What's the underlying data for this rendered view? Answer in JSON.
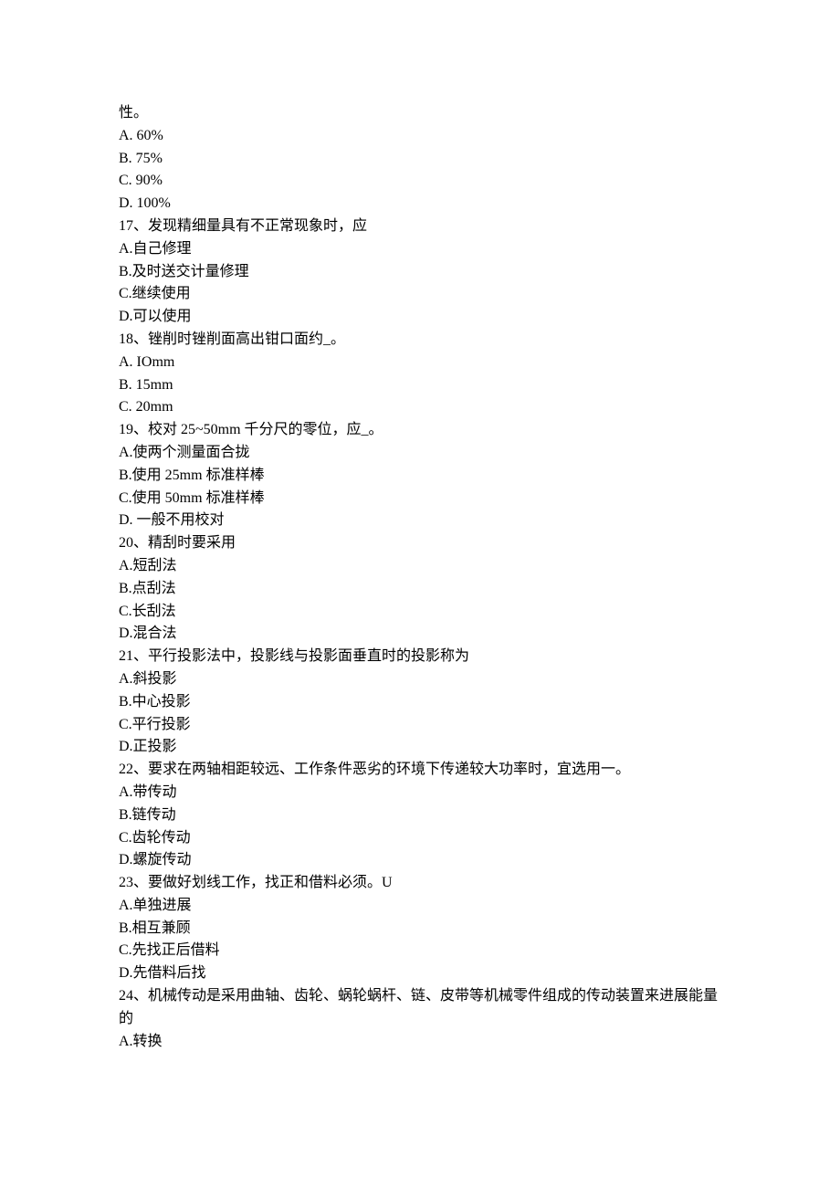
{
  "lines": [
    "性。",
    "A.   60%",
    "B.   75%",
    "C.   90%",
    "D.   100%",
    "17、发现精细量具有不正常现象时，应",
    "A.自己修理",
    "B.及时送交计量修理",
    "C.继续使用",
    "D.可以使用",
    "18、锉削时锉削面高出钳口面约_。",
    "A.   IOmm",
    "B.   15mm",
    "C.   20mm",
    "19、校对 25~50mm 千分尺的零位，应_。",
    "A.使两个测量面合拢",
    "B.使用 25mm 标准样棒",
    "C.使用 50mm 标准样棒",
    "D.   一般不用校对",
    "20、精刮时要采用",
    "A.短刮法",
    "B.点刮法",
    "C.长刮法",
    "D.混合法",
    "21、平行投影法中，投影线与投影面垂直时的投影称为",
    "A.斜投影",
    "B.中心投影",
    "C.平行投影",
    "D.正投影",
    "22、要求在两轴相距较远、工作条件恶劣的环境下传递较大功率时，宜选用一。",
    "A.带传动",
    "B.链传动",
    "C.齿轮传动",
    "D.螺旋传动",
    "23、要做好划线工作，找正和借料必须。U",
    "A.单独进展",
    "B.相互兼顾",
    "C.先找正后借料",
    "D.先借料后找",
    "24、机械传动是采用曲轴、齿轮、蜗轮蜗杆、链、皮带等机械零件组成的传动装置来进展能量的",
    "A.转换"
  ]
}
